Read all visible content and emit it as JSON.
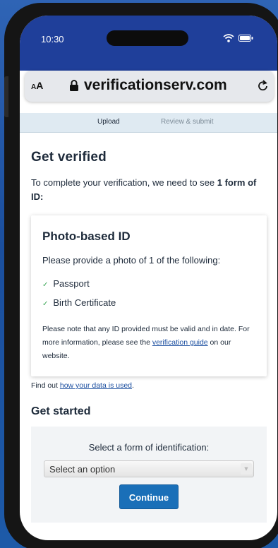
{
  "status_bar": {
    "time": "10:30"
  },
  "browser": {
    "text_size_label_small": "A",
    "text_size_label_large": "A",
    "domain": "verificationserv.com"
  },
  "steps": {
    "current": "Upload",
    "next": "Review & submit"
  },
  "page": {
    "title": "Get verified",
    "intro_prefix": "To complete your verification, we need to see ",
    "intro_bold": "1 form of ID:",
    "card": {
      "title": "Photo-based ID",
      "subtitle": "Please provide a photo of 1 of the following:",
      "items": [
        "Passport",
        "Birth Certificate"
      ],
      "note_prefix": "Please note that any ID provided must be valid and in date. For more information, please see the ",
      "note_link": "verification guide",
      "note_suffix": " on our website."
    },
    "data_prefix": "Find out ",
    "data_link": "how your data is used",
    "data_suffix": ".",
    "get_started": {
      "heading": "Get started",
      "label": "Select a form of identification:",
      "select_value": "Select an option",
      "button": "Continue"
    }
  },
  "colors": {
    "status_bar": "#1f3f9a",
    "stepper_bg": "#dfeaf2",
    "link": "#1c4fa0",
    "primary_button": "#1a6fb8",
    "check": "#3aa655"
  }
}
